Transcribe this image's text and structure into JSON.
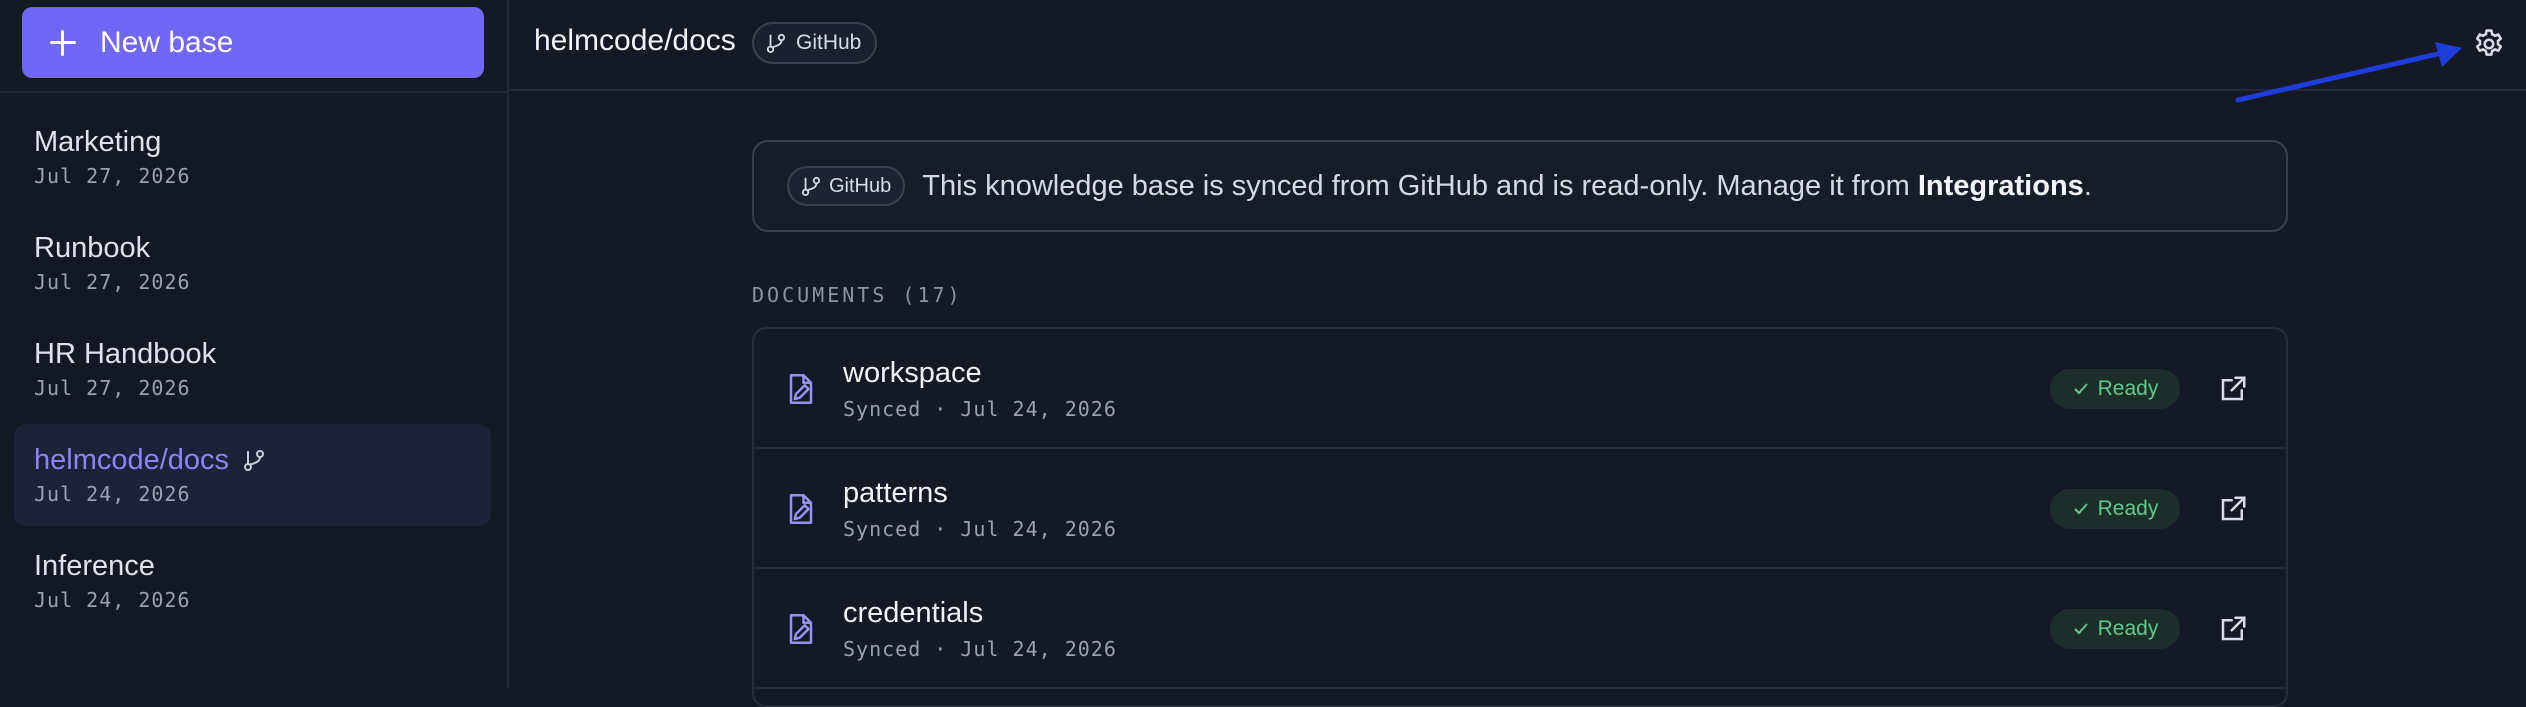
{
  "sidebar": {
    "new_base_label": "New base",
    "items": [
      {
        "name": "Marketing",
        "date": "Jul 27, 2026",
        "active": false
      },
      {
        "name": "Runbook",
        "date": "Jul 27, 2026",
        "active": false
      },
      {
        "name": "HR Handbook",
        "date": "Jul 27, 2026",
        "active": false
      },
      {
        "name": "helmcode/docs",
        "date": "Jul 24, 2026",
        "active": true
      },
      {
        "name": "Inference",
        "date": "Jul 24, 2026",
        "active": false
      }
    ]
  },
  "header": {
    "title": "helmcode/docs",
    "source_chip": "GitHub",
    "settings_icon": "gear-icon"
  },
  "notice": {
    "chip": "GitHub",
    "text": "This knowledge base is synced from GitHub and is read-only. Manage it from ",
    "link": "Integrations",
    "suffix": "."
  },
  "documents": {
    "heading": "DOCUMENTS (17)",
    "rows": [
      {
        "title": "workspace",
        "meta": "Synced · Jul 24, 2026",
        "status": "Ready"
      },
      {
        "title": "patterns",
        "meta": "Synced · Jul 24, 2026",
        "status": "Ready"
      },
      {
        "title": "credentials",
        "meta": "Synced · Jul 24, 2026",
        "status": "Ready"
      }
    ]
  },
  "colors": {
    "accent": "#6e68f5",
    "active_text": "#8b84f8",
    "ready": "#5fc98b",
    "annotation_arrow": "#1f3ddb"
  }
}
